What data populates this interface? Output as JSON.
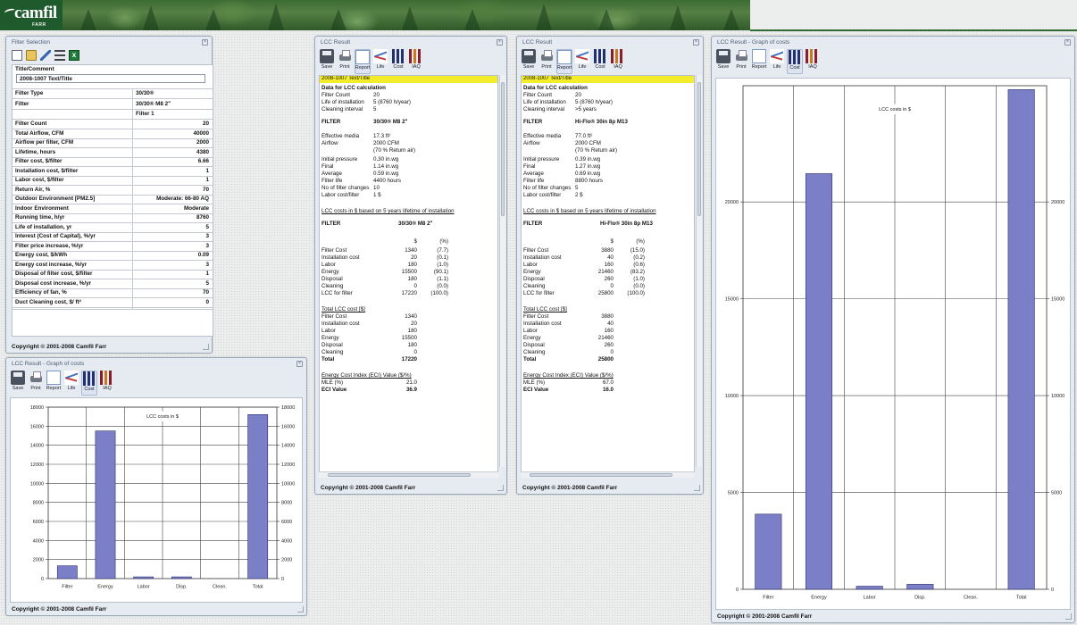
{
  "brand": {
    "name": "camfil",
    "sub": "FARR"
  },
  "toolbar_labels": [
    "Save",
    "Print",
    "Report",
    "Life",
    "Cost",
    "IAQ"
  ],
  "filter_selection": {
    "title": "Filter Selection",
    "comment_label": "Title/Comment",
    "comment_value": "2008-1007 Text/Title",
    "filter_type_label": "Filter Type",
    "filter_type_value": "30/30®",
    "filter_label": "Filter",
    "filter_value": "30/30® M8 2\"",
    "column_header": "Filter 1",
    "rows": [
      {
        "label": "Filter Count",
        "value": "20"
      },
      {
        "label": "Total Airflow, CFM",
        "value": "40000"
      },
      {
        "label": "Airflow per filter, CFM",
        "value": "2000"
      },
      {
        "label": "Lifetime, hours",
        "value": "4380"
      },
      {
        "label": "Filter cost, $/filter",
        "value": "6.66"
      },
      {
        "label": "Installation cost, $/filter",
        "value": "1"
      },
      {
        "label": "Labor cost, $/filter",
        "value": "1"
      },
      {
        "label": "Return Air, %",
        "value": "70"
      },
      {
        "label": "Outdoor Environment [PM2.5]",
        "value": "Moderate: 66-80 AQ"
      },
      {
        "label": "Indoor Environment",
        "value": "Moderate"
      },
      {
        "label": "Running time, h/yr",
        "value": "8760"
      },
      {
        "label": "Life of installation, yr",
        "value": "5"
      },
      {
        "label": "Interest (Cost of Capital), %/yr",
        "value": "3"
      },
      {
        "label": "Filter price increase, %/yr",
        "value": "3"
      },
      {
        "label": "Energy cost, $/kWh",
        "value": "0.09"
      },
      {
        "label": "Energy cost increase, %/yr",
        "value": "3"
      },
      {
        "label": "Disposal of filter cost, $/filter",
        "value": "1"
      },
      {
        "label": "Disposal cost increase, %/yr",
        "value": "5"
      },
      {
        "label": "Efficiency of fan, %",
        "value": "70"
      },
      {
        "label": "Duct Cleaning cost, $/ ft²",
        "value": "0"
      }
    ],
    "copyright": "Copyright © 2001-2008 Camfil Farr"
  },
  "lcc1": {
    "title": "LCC Result",
    "highlight": "2008-1007 Text/Title",
    "data_header": "Data for LCC calculation",
    "filter_count_label": "Filter Count",
    "filter_count": "20",
    "life_label": "Life of installation",
    "life": "5 (8760 h/year)",
    "cleaning_label": "Cleaning interval",
    "cleaning": "5",
    "filter_label": "FILTER",
    "filter_name": "30/30® M8 2\"",
    "eff_media_label": "Effective media",
    "eff_media": "17.3 ft²",
    "airflow_label": "Airflow",
    "airflow": "2000 CFM",
    "airflow_note": "(70 % Return air)",
    "initial_label": "Initial pressure",
    "initial": "0.30 in.wg",
    "final_label": "Final",
    "final": "1.14 in.wg",
    "average_label": "Average",
    "average": "0.59 in.wg",
    "filter_life_label": "Filter life",
    "filter_life": "4400 hours",
    "changes_label": "No of filter changes",
    "changes": "10",
    "labor_label": "Labor cost/filter",
    "labor": "1 $",
    "lcc_link": "LCC costs in $ based on 5 years lifetime of installation",
    "col_dollar": "$",
    "col_pct": "(%)",
    "cost_rows": [
      {
        "label": "Filter Cost",
        "value": "1340",
        "pct": "(7.7)"
      },
      {
        "label": "Installation cost",
        "value": "20",
        "pct": "(0.1)"
      },
      {
        "label": "Labor",
        "value": "180",
        "pct": "(1.0)"
      },
      {
        "label": "Energy",
        "value": "15500",
        "pct": "(90.1)"
      },
      {
        "label": "Disposal",
        "value": "180",
        "pct": "(1.1)"
      },
      {
        "label": "Cleaning",
        "value": "0",
        "pct": "(0.0)"
      },
      {
        "label": "LCC for filter",
        "value": "17220",
        "pct": "(100.0)"
      }
    ],
    "total_header": "Total LCC cost [$]",
    "total_rows": [
      {
        "label": "Filter Cost",
        "value": "1340"
      },
      {
        "label": "Installation cost",
        "value": "20"
      },
      {
        "label": "Labor",
        "value": "180"
      },
      {
        "label": "Energy",
        "value": "15500"
      },
      {
        "label": "Disposal",
        "value": "180"
      },
      {
        "label": "Cleaning",
        "value": "0"
      }
    ],
    "total_label": "Total",
    "total_value": "17220",
    "eci_header": "Energy Cost Index (ECI) Value ($/%)",
    "mle_label": "MLE (%)",
    "mle": "21.0",
    "eci_label": "ECI Value",
    "eci": "36.9",
    "copyright": "Copyright © 2001-2008 Camfil Farr"
  },
  "lcc2": {
    "title": "LCC Result",
    "highlight": "2008-1007 Text/Title",
    "data_header": "Data for LCC calculation",
    "filter_count_label": "Filter Count",
    "filter_count": "20",
    "life_label": "Life of installation",
    "life": "5 (8760 h/year)",
    "cleaning_label": "Cleaning interval",
    "cleaning": ">5 years",
    "filter_label": "FILTER",
    "filter_name": "Hi-Flo® 30in 8p M13",
    "eff_media_label": "Effective media",
    "eff_media": "77.0 ft²",
    "airflow_label": "Airflow",
    "airflow": "2000 CFM",
    "airflow_note": "(70 % Return air)",
    "initial_label": "Initial pressure",
    "initial": "0.39 in.wg",
    "final_label": "Final",
    "final": "1.27 in.wg",
    "average_label": "Average",
    "average": "0.69 in.wg",
    "filter_life_label": "Filter life",
    "filter_life": "8800 hours",
    "changes_label": "No of filter changes",
    "changes": "5",
    "labor_label": "Labor cost/filter",
    "labor": "2 $",
    "lcc_link": "LCC costs in $ based on 5 years lifetime of installation",
    "col_dollar": "$",
    "col_pct": "(%)",
    "cost_rows": [
      {
        "label": "Filter Cost",
        "value": "3880",
        "pct": "(15.0)"
      },
      {
        "label": "Installation cost",
        "value": "40",
        "pct": "(0.2)"
      },
      {
        "label": "Labor",
        "value": "160",
        "pct": "(0.6)"
      },
      {
        "label": "Energy",
        "value": "21460",
        "pct": "(83.2)"
      },
      {
        "label": "Disposal",
        "value": "260",
        "pct": "(1.0)"
      },
      {
        "label": "Cleaning",
        "value": "0",
        "pct": "(0.0)"
      },
      {
        "label": "LCC for filter",
        "value": "25800",
        "pct": "(100.0)"
      }
    ],
    "total_header": "Total LCC cost [$]",
    "total_rows": [
      {
        "label": "Filter Cost",
        "value": "3880"
      },
      {
        "label": "Installation cost",
        "value": "40"
      },
      {
        "label": "Labor",
        "value": "160"
      },
      {
        "label": "Energy",
        "value": "21460"
      },
      {
        "label": "Disposal",
        "value": "260"
      },
      {
        "label": "Cleaning",
        "value": "0"
      }
    ],
    "total_label": "Total",
    "total_value": "25800",
    "eci_header": "Energy Cost Index (ECI) Value ($/%)",
    "mle_label": "MLE (%)",
    "mle": "67.0",
    "eci_label": "ECI Value",
    "eci": "16.0",
    "copyright": "Copyright © 2001-2008 Camfil Farr"
  },
  "graph_small": {
    "title": "LCC Result - Graph of costs",
    "copyright": "Copyright © 2001-2008 Camfil Farr"
  },
  "graph_large": {
    "title": "LCC Result - Graph of costs",
    "copyright": "Copyright © 2001-2008 Camfil Farr"
  },
  "chart_data": [
    {
      "type": "bar",
      "title": "LCC costs in $",
      "categories": [
        "Filter",
        "Energy",
        "Labor",
        "Disp.",
        "Clean.",
        "Total"
      ],
      "values": [
        1340,
        15500,
        180,
        180,
        0,
        17220
      ],
      "ylim": [
        0,
        18000
      ],
      "yticks": [
        0,
        2000,
        4000,
        6000,
        8000,
        10000,
        12000,
        14000,
        16000,
        18000
      ],
      "bar_color": "#7b7fc7",
      "grid": true
    },
    {
      "type": "bar",
      "title": "LCC costs in $",
      "categories": [
        "Filter",
        "Energy",
        "Labor",
        "Disp.",
        "Clean.",
        "Total"
      ],
      "values": [
        3880,
        21460,
        160,
        260,
        0,
        25800
      ],
      "ylim": [
        0,
        26000
      ],
      "yticks": [
        0,
        5000,
        10000,
        15000,
        20000
      ],
      "bar_color": "#7b7fc7",
      "grid": true
    }
  ]
}
